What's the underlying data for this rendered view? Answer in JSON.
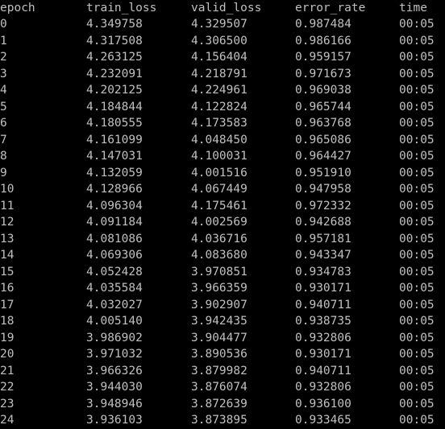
{
  "columns": [
    "epoch",
    "train_loss",
    "valid_loss",
    "error_rate",
    "time"
  ],
  "rows": [
    [
      "0",
      "4.349758",
      "4.329507",
      "0.987484",
      "00:05"
    ],
    [
      "1",
      "4.317508",
      "4.306500",
      "0.986166",
      "00:05"
    ],
    [
      "2",
      "4.263125",
      "4.156404",
      "0.959157",
      "00:05"
    ],
    [
      "3",
      "4.232091",
      "4.218791",
      "0.971673",
      "00:05"
    ],
    [
      "4",
      "4.202125",
      "4.224961",
      "0.969038",
      "00:05"
    ],
    [
      "5",
      "4.184844",
      "4.122824",
      "0.965744",
      "00:05"
    ],
    [
      "6",
      "4.180555",
      "4.173583",
      "0.963768",
      "00:05"
    ],
    [
      "7",
      "4.161099",
      "4.048450",
      "0.965086",
      "00:05"
    ],
    [
      "8",
      "4.147031",
      "4.100031",
      "0.964427",
      "00:05"
    ],
    [
      "9",
      "4.132059",
      "4.001516",
      "0.951910",
      "00:05"
    ],
    [
      "10",
      "4.128966",
      "4.067449",
      "0.947958",
      "00:05"
    ],
    [
      "11",
      "4.096304",
      "4.175461",
      "0.972332",
      "00:05"
    ],
    [
      "12",
      "4.091184",
      "4.002569",
      "0.942688",
      "00:05"
    ],
    [
      "13",
      "4.081086",
      "4.036716",
      "0.957181",
      "00:05"
    ],
    [
      "14",
      "4.069306",
      "4.083680",
      "0.943347",
      "00:05"
    ],
    [
      "15",
      "4.052428",
      "3.970851",
      "0.934783",
      "00:05"
    ],
    [
      "16",
      "4.035584",
      "3.966359",
      "0.930171",
      "00:05"
    ],
    [
      "17",
      "4.032027",
      "3.902907",
      "0.940711",
      "00:05"
    ],
    [
      "18",
      "4.005140",
      "3.942435",
      "0.938735",
      "00:05"
    ],
    [
      "19",
      "3.986902",
      "3.904477",
      "0.932806",
      "00:05"
    ],
    [
      "20",
      "3.971032",
      "3.890536",
      "0.930171",
      "00:05"
    ],
    [
      "21",
      "3.966326",
      "3.879982",
      "0.940711",
      "00:05"
    ],
    [
      "22",
      "3.944030",
      "3.876074",
      "0.932806",
      "00:05"
    ],
    [
      "23",
      "3.948946",
      "3.872639",
      "0.936100",
      "00:05"
    ],
    [
      "24",
      "3.936103",
      "3.873895",
      "0.933465",
      "00:05"
    ]
  ],
  "colors": {
    "background": "#000000",
    "text": "#c0c0c0"
  }
}
